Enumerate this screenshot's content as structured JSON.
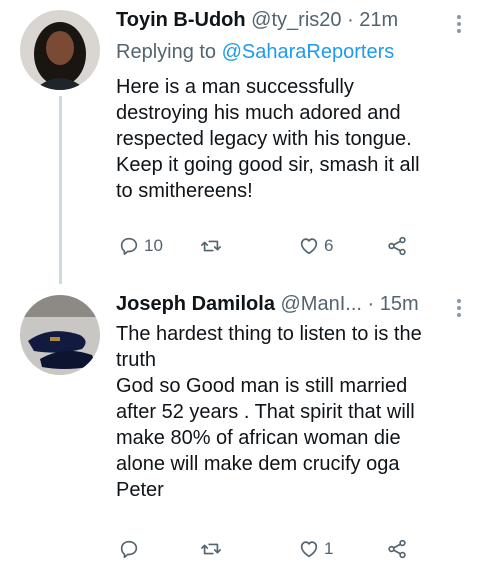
{
  "tweets": [
    {
      "name": "Toyin B-Udoh",
      "handle": "@ty_ris20",
      "time": "· 21m",
      "replying_prefix": "Replying to",
      "replying_to": "@SaharaReporters",
      "text_lines": [
        "Here is a man successfully",
        "destroying his much adored and",
        "respected legacy with his tongue.",
        "Keep it going good sir, smash it all",
        "to smithereens!"
      ],
      "reply_count": "10",
      "retweet_count": "",
      "like_count": "6",
      "avatar": "avatar-woman"
    },
    {
      "name": "Joseph Damilola",
      "handle": "@ManI...",
      "time": "· 15m",
      "text_lines": [
        "The hardest thing to listen to is the",
        "truth",
        "God so Good man is still married",
        "after 52 years . That spirit that will",
        "make 80% of african woman die",
        "alone will make dem crucify oga",
        "Peter"
      ],
      "reply_count": "",
      "retweet_count": "",
      "like_count": "1",
      "avatar": "avatar-shoes"
    }
  ],
  "icons": {
    "reply": "reply-icon",
    "retweet": "retweet-icon",
    "like": "like-icon",
    "share": "share-icon",
    "more": "more-icon"
  },
  "colors": {
    "accent": "#1d9bf0",
    "secondary_text": "#536471",
    "thread_line": "#cfd9de"
  }
}
